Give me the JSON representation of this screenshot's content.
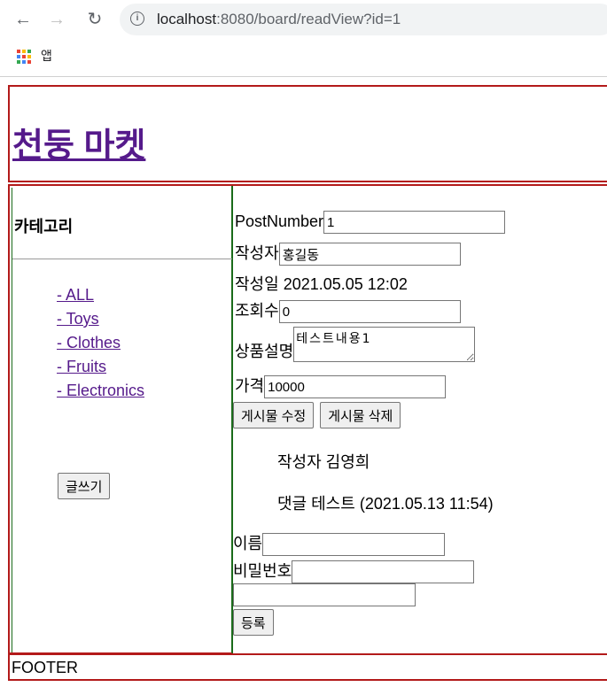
{
  "browser": {
    "url_host": "localhost",
    "url_rest": ":8080/board/readView?id=1",
    "bookmark_apps": "앱"
  },
  "site": {
    "title": "천둥 마켓"
  },
  "sidebar": {
    "title": "카테고리",
    "categories": [
      "- ALL",
      "- Toys",
      "- Clothes",
      "- Fruits",
      "- Electronics"
    ],
    "write_button": "글쓰기"
  },
  "post": {
    "number_label": "PostNumber",
    "number_value": "1",
    "writer_label": "작성자",
    "writer_value": "홍길동",
    "date_label": "작성일",
    "date_value": "2021.05.05 12:02",
    "views_label": "조회수",
    "views_value": "0",
    "desc_label": "상품설명",
    "desc_value": "테스트내용1",
    "price_label": "가격",
    "price_value": "10000",
    "edit_button": "게시물 수정",
    "delete_button": "게시물 삭제"
  },
  "comment": {
    "writer_text": "작성자 김영희",
    "content_text": "댓글 테스트",
    "date_text": "(2021.05.13 11:54)"
  },
  "reply_form": {
    "name_label": "이름",
    "password_label": "비밀번호",
    "submit_button": "등록"
  },
  "footer": {
    "text": "FOOTER"
  }
}
